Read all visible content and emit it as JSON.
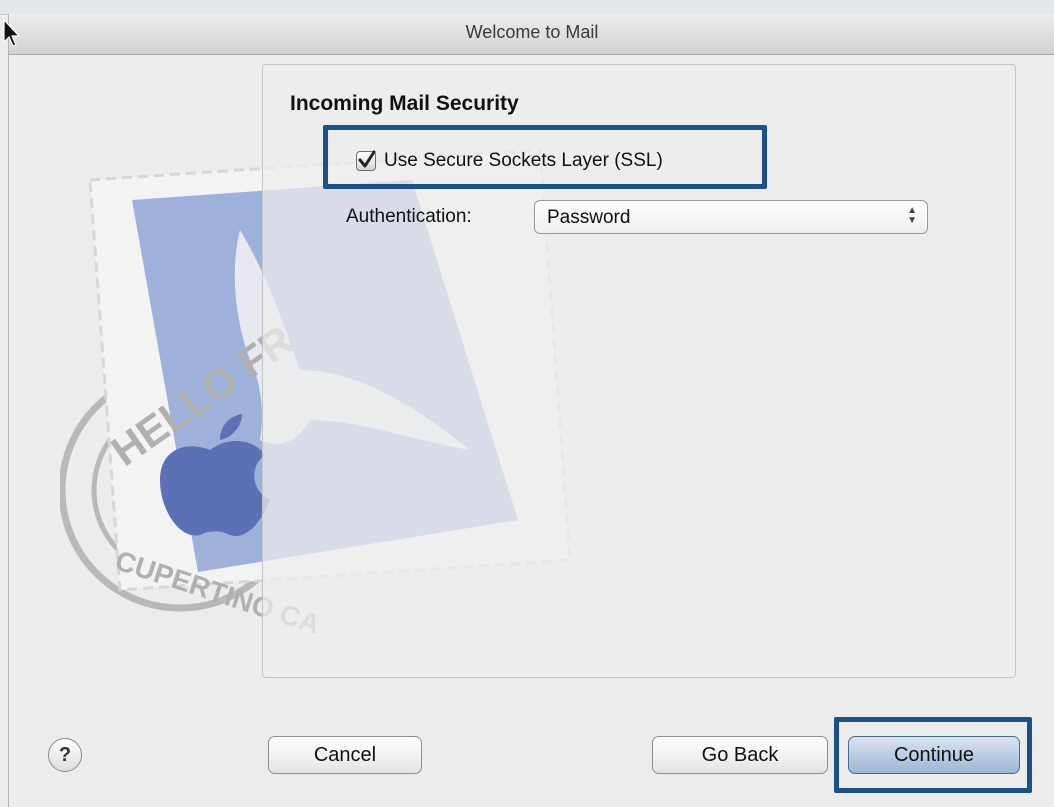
{
  "window": {
    "title": "Welcome to Mail"
  },
  "stamp": {
    "top_text": "HELLO FR",
    "bottom_text": "CUPERTINO CA"
  },
  "security": {
    "section_title": "Incoming Mail Security",
    "ssl_label": "Use Secure Sockets Layer (SSL)",
    "ssl_checked": true,
    "auth_label": "Authentication:",
    "auth_value": "Password"
  },
  "buttons": {
    "help": "?",
    "cancel": "Cancel",
    "go_back": "Go Back",
    "continue": "Continue"
  },
  "colors": {
    "highlight": "#1d4f8a",
    "default_button": "#9fb5d2"
  }
}
